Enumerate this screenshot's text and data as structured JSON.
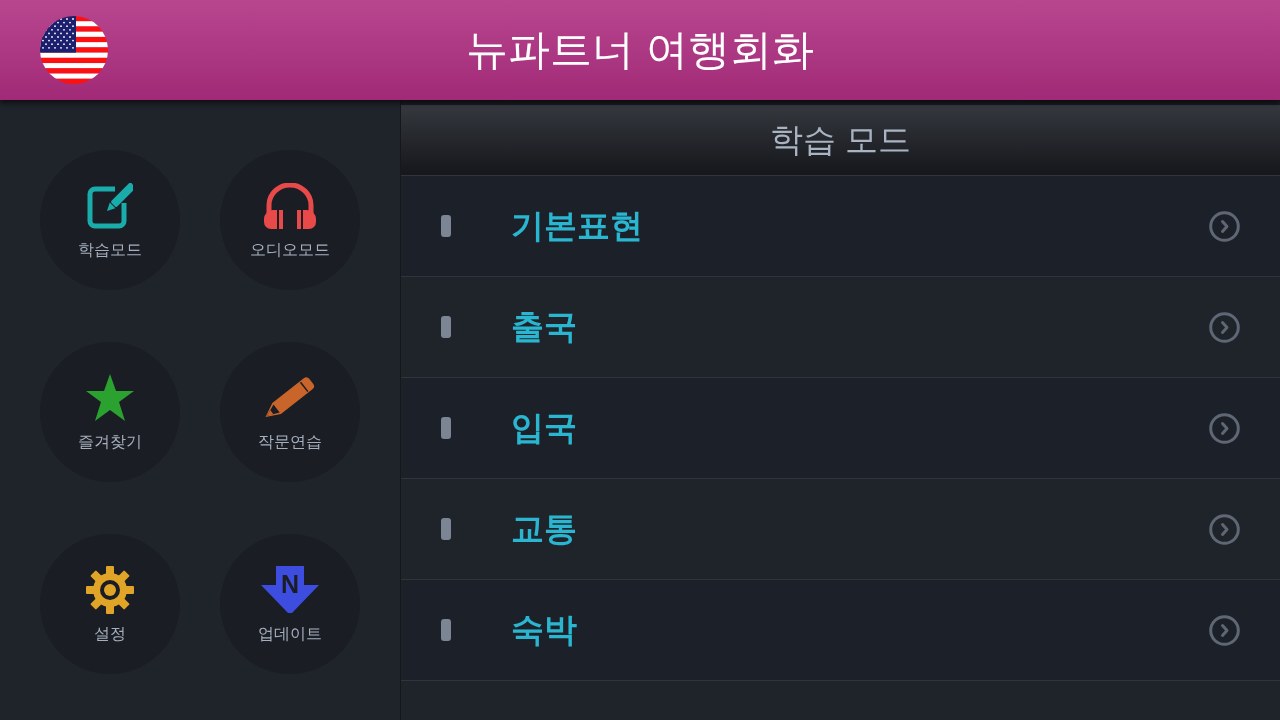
{
  "header": {
    "title": "뉴파트너 여행회화"
  },
  "menu": [
    {
      "kind": "study",
      "label": "학습모드"
    },
    {
      "kind": "audio",
      "label": "오디오모드"
    },
    {
      "kind": "favorites",
      "label": "즐겨찾기"
    },
    {
      "kind": "writing",
      "label": "작문연습"
    },
    {
      "kind": "settings",
      "label": "설정"
    },
    {
      "kind": "update",
      "label": "업데이트"
    }
  ],
  "update_logo": {
    "text": "N"
  },
  "panel": {
    "title": "학습 모드",
    "items": [
      {
        "label": "기본표현"
      },
      {
        "label": "출국"
      },
      {
        "label": "입국"
      },
      {
        "label": "교통"
      },
      {
        "label": "숙박"
      }
    ]
  }
}
